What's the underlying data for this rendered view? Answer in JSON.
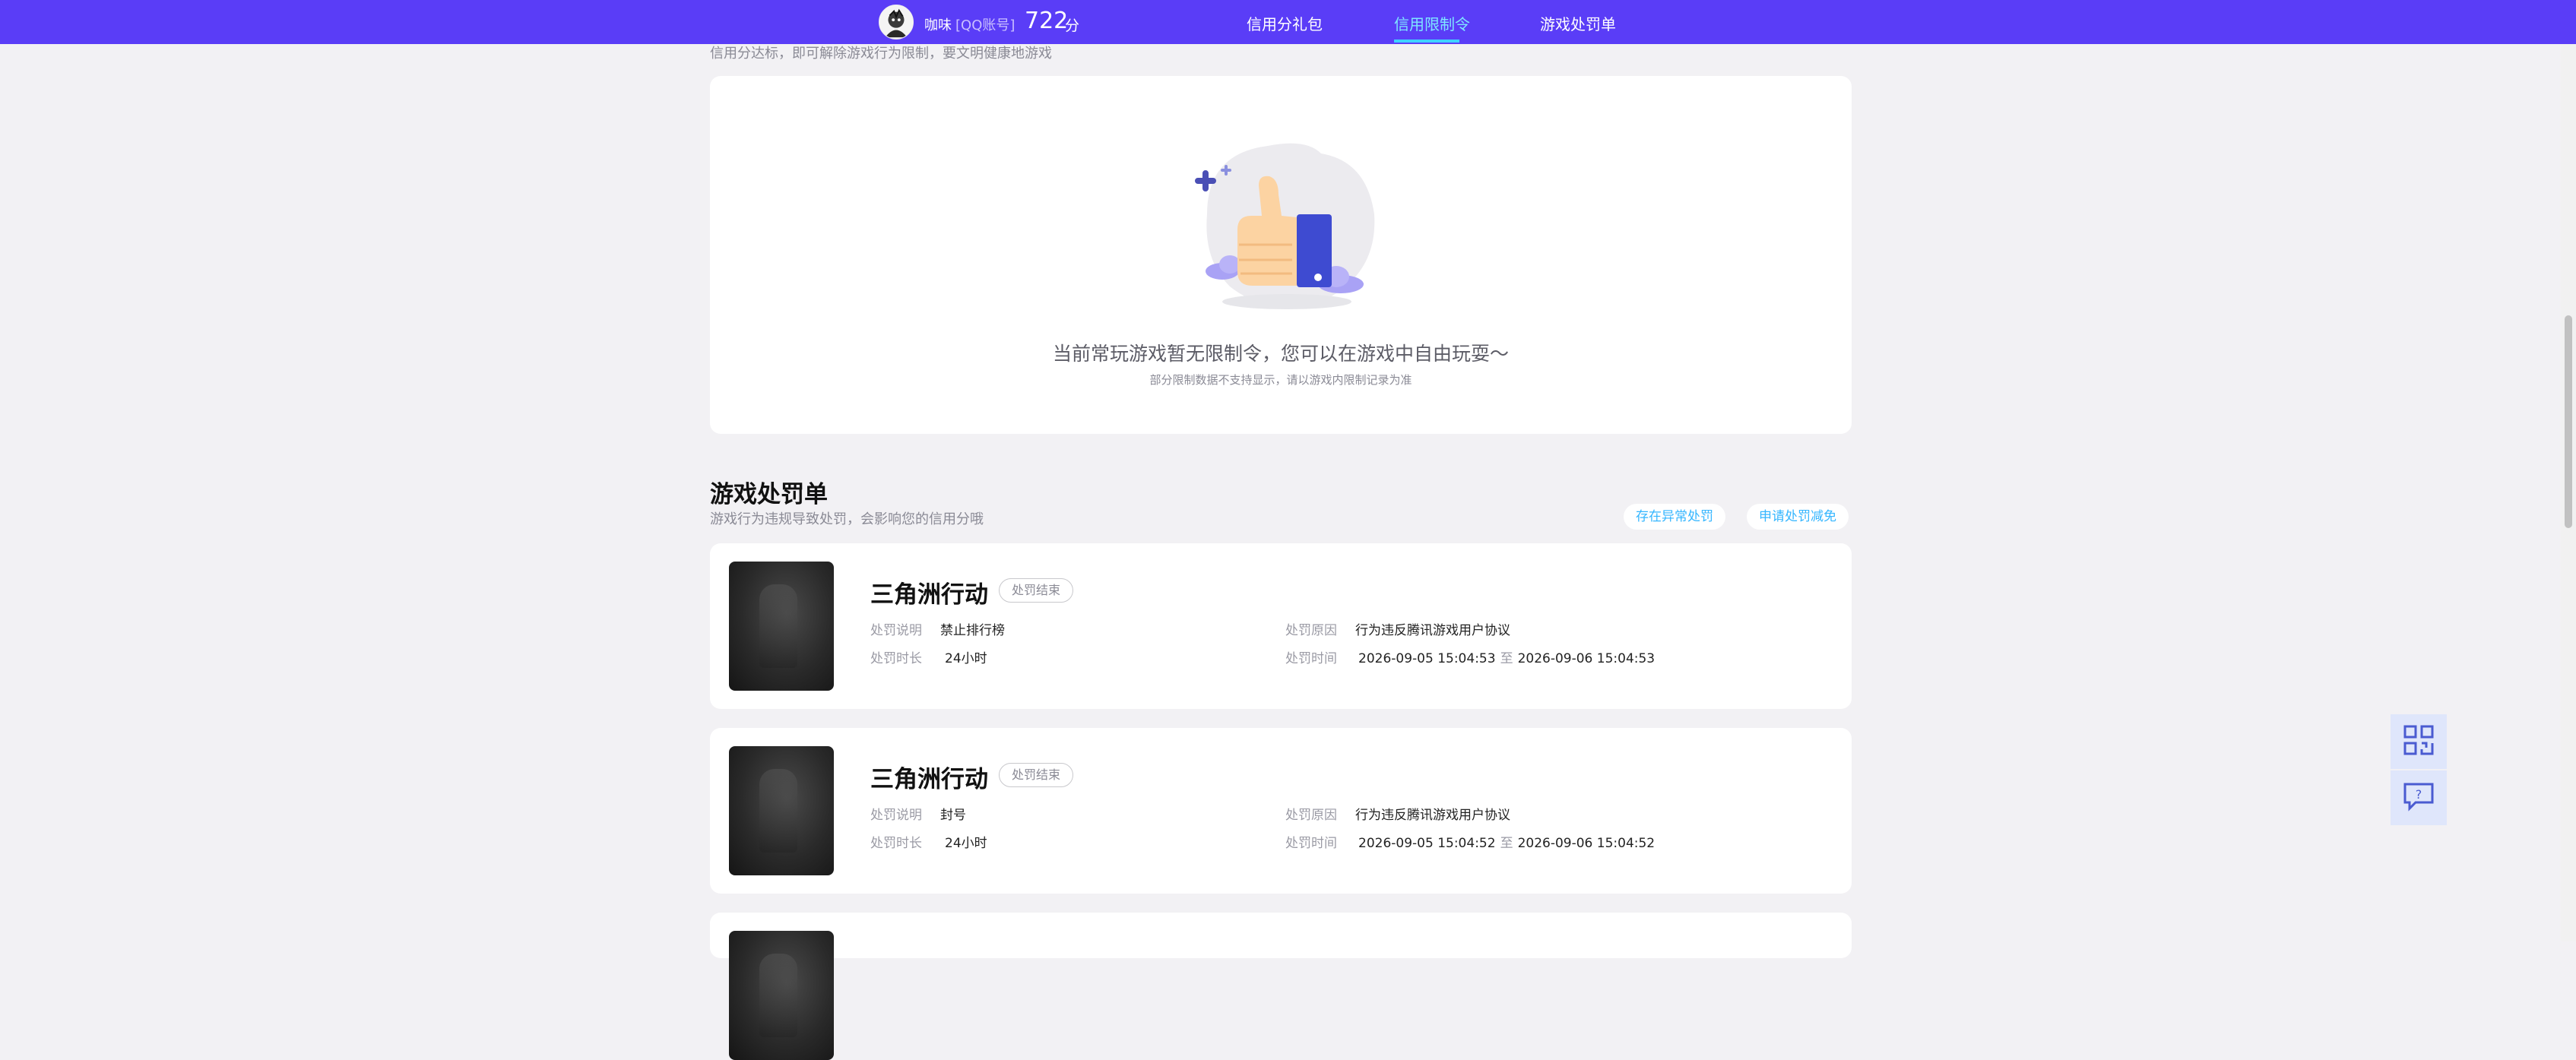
{
  "header": {
    "username": "咖味",
    "account_type": "[QQ账号]",
    "score": "722",
    "score_unit": "分",
    "nav": [
      {
        "label": "信用分礼包",
        "active": false
      },
      {
        "label": "信用限制令",
        "active": true
      },
      {
        "label": "游戏处罚单",
        "active": false
      }
    ],
    "active_color": "#7ee6ff",
    "bar_color": "#5a3df7"
  },
  "restriction": {
    "description": "信用分达标，即可解除游戏行为限制，要文明健康地游戏",
    "empty_message": "当前常玩游戏暂无限制令，您可以在游戏中自由玩耍～",
    "empty_note": "部分限制数据不支持显示，请以游戏内限制记录为准"
  },
  "penalty": {
    "title": "游戏处罚单",
    "subtitle": "游戏行为违规导致处罚，会影响您的信用分哦",
    "buttons": [
      "存在异常处罚",
      "申请处罚减免"
    ],
    "labels": {
      "desc": "处罚说明",
      "duration": "处罚时长",
      "reason": "处罚原因",
      "time": "处罚时间"
    },
    "time_separator": "至",
    "items": [
      {
        "game": "三角洲行动",
        "status": "处罚结束",
        "desc": "禁止排行榜",
        "duration": "24小时",
        "reason": "行为违反腾讯游戏用户协议",
        "time_start": "2026-09-05 15:04:53",
        "time_end": "2026-09-06 15:04:53"
      },
      {
        "game": "三角洲行动",
        "status": "处罚结束",
        "desc": "封号",
        "duration": "24小时",
        "reason": "行为违反腾讯游戏用户协议",
        "time_start": "2026-09-05 15:04:52",
        "time_end": "2026-09-06 15:04:52"
      }
    ]
  },
  "side_tools": {
    "icons": [
      "qr-code-icon",
      "help-chat-icon"
    ]
  }
}
